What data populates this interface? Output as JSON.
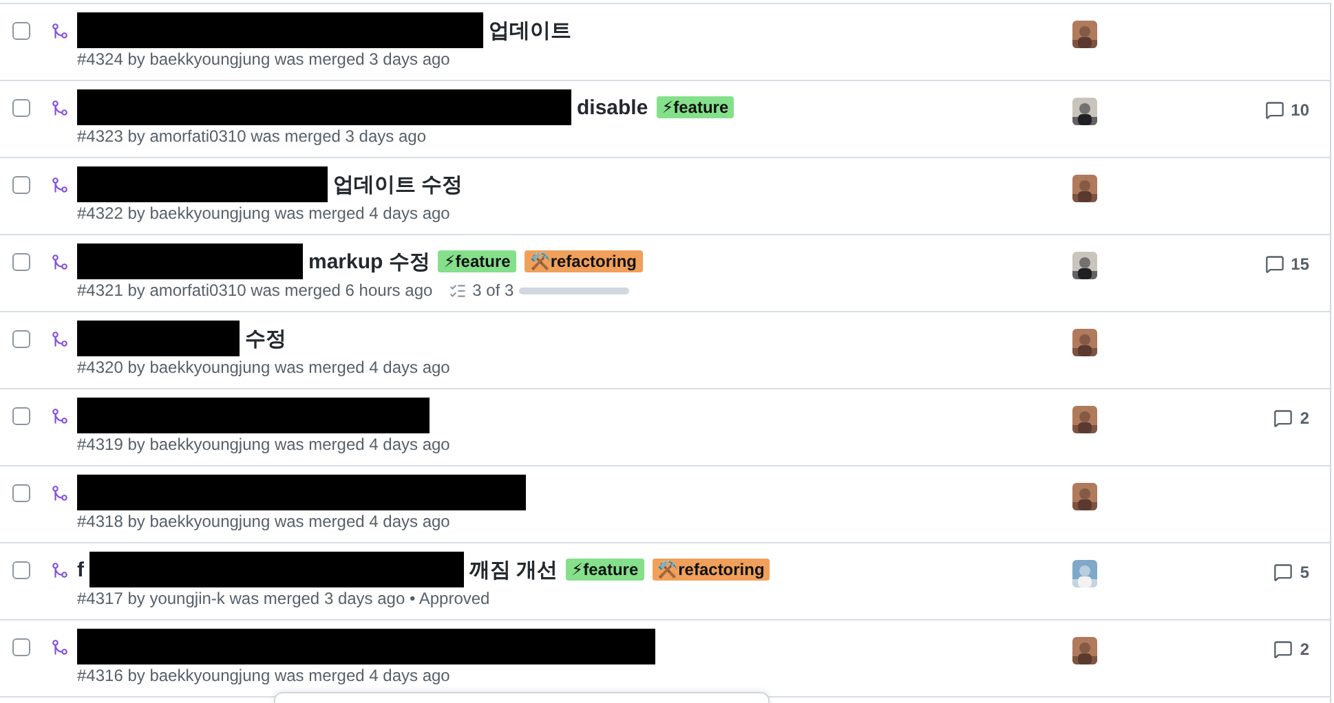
{
  "pull_requests": [
    {
      "selected": false,
      "title": "업데이트",
      "meta": "#4324 by baekkyoungjung was merged 3 days ago"
    },
    {
      "selected": false,
      "title": "disable",
      "labels": [
        {
          "icon": "⚡",
          "name": "feature",
          "color": "#84e08a"
        }
      ],
      "meta": "#4323 by amorfati0310 was merged 3 days ago",
      "comments": "10"
    },
    {
      "selected": false,
      "title": "업데이트 수정",
      "meta": "#4322 by baekkyoungjung was merged 4 days ago"
    },
    {
      "selected": false,
      "title": "markup 수정",
      "labels": [
        {
          "icon": "⚡",
          "name": "feature",
          "color": "#84e08a"
        },
        {
          "icon": "⚒️",
          "name": "refactoring",
          "color": "#f0a05a"
        }
      ],
      "meta": "#4321 by amorfati0310 was merged 6 hours ago",
      "tasks": {
        "text": "3 of 3",
        "level": 1
      },
      "comments": "15"
    },
    {
      "selected": false,
      "title": "수정",
      "meta": "#4320 by baekkyoungjung was merged 4 days ago"
    },
    {
      "selected": false,
      "meta": "#4319 by baekkyoungjung was merged 4 days ago",
      "comments": "2"
    },
    {
      "selected": false,
      "meta": "#4318 by baekkyoungjung was merged 4 days ago"
    },
    {
      "selected": false,
      "title_prefix": "f",
      "title": "깨짐 개선",
      "labels": [
        {
          "icon": "⚡",
          "name": "feature",
          "color": "#84e08a"
        },
        {
          "icon": "⚒️",
          "name": "refactoring",
          "color": "#f0a05a"
        }
      ],
      "meta": "#4317 by youngjin-k was merged 3 days ago • Approved",
      "comments": "5"
    },
    {
      "selected": false,
      "meta": "#4316 by baekkyoungjung was merged 4 days ago",
      "comments": "2"
    }
  ]
}
